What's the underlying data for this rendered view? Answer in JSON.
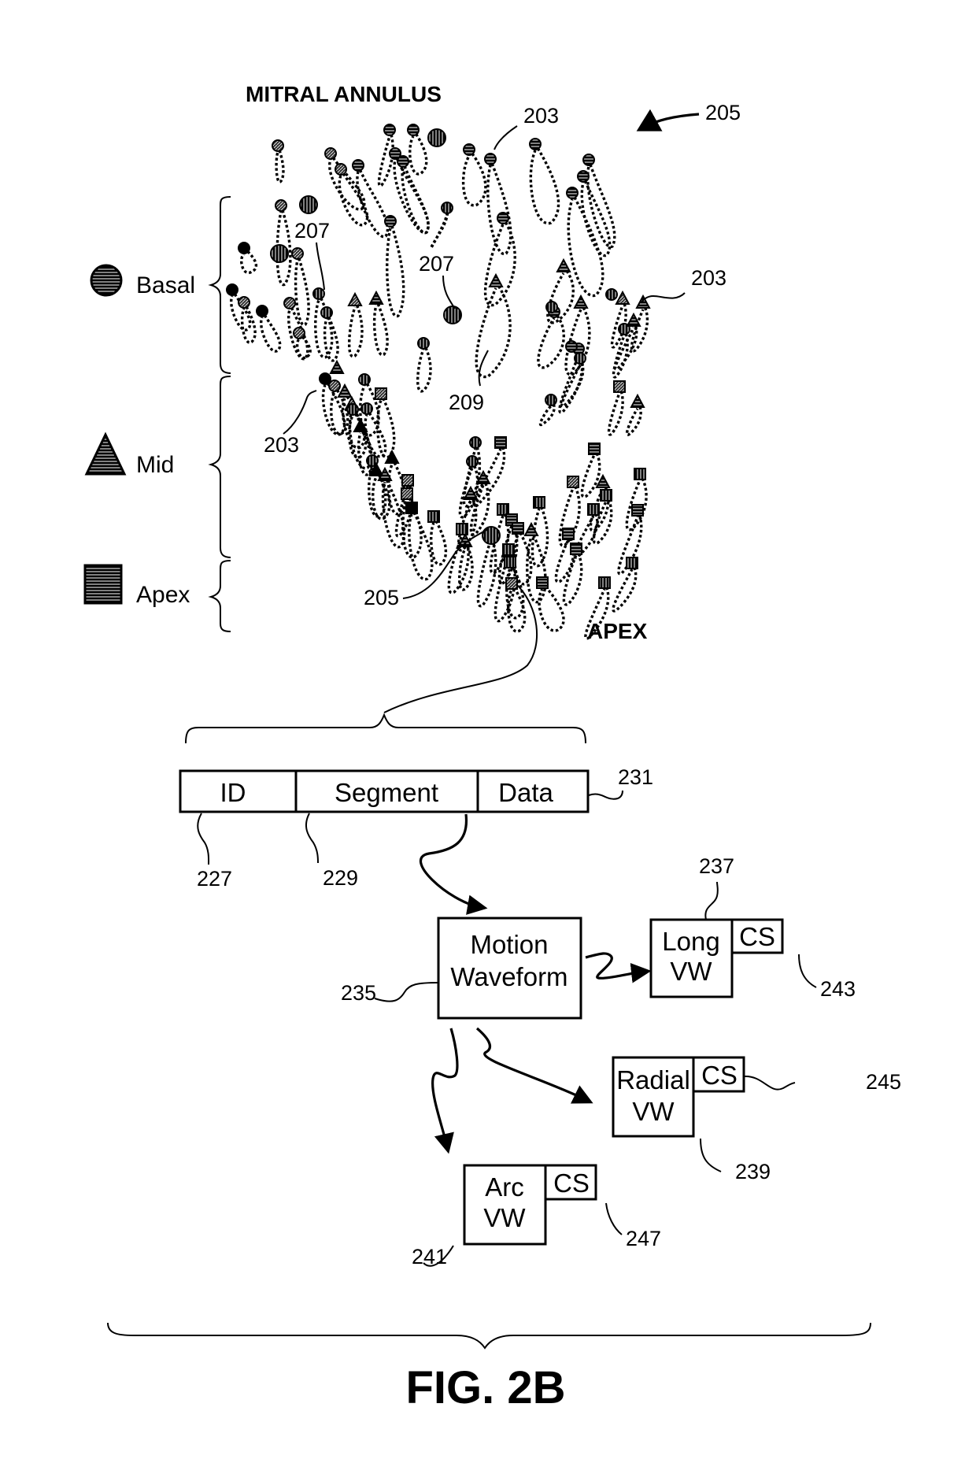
{
  "figure": {
    "caption": "FIG. 2B",
    "top_label": "MITRAL ANNULUS",
    "bottom_label": "APEX",
    "background_color": "#ffffff",
    "ink_color": "#000000"
  },
  "legend": [
    {
      "name": "Basal",
      "marker": "circle",
      "fill": "horizontal-hatch"
    },
    {
      "name": "Mid",
      "marker": "triangle",
      "fill": "horizontal-hatch"
    },
    {
      "name": "Apex",
      "marker": "square",
      "fill": "horizontal-hatch"
    }
  ],
  "reference_numerals": {
    "heart_model": "205",
    "trajectory_a": "203",
    "trajectory_b": "203",
    "trajectory_c": "203",
    "point_a": "207",
    "point_b": "207",
    "trajectory_loop": "209",
    "selected_point": "205",
    "record": "231",
    "id_field": "227",
    "segment_field": "229",
    "motion_waveform": "235",
    "long_vw": "237",
    "long_cs": "243",
    "radial_vw": "239",
    "radial_cs": "245",
    "arc_vw": "241",
    "arc_cs": "247"
  },
  "record_fields": [
    "ID",
    "Segment",
    "Data"
  ],
  "boxes": {
    "motion_waveform": [
      "Motion",
      "Waveform"
    ],
    "long": [
      "Long",
      "VW"
    ],
    "radial": [
      "Radial",
      "VW"
    ],
    "arc": [
      "Arc",
      "VW"
    ],
    "cs": "CS"
  }
}
